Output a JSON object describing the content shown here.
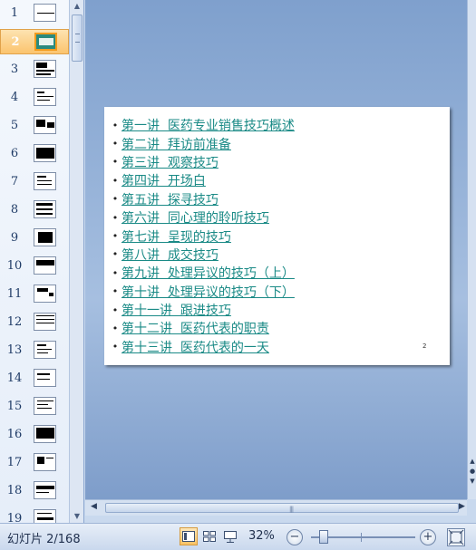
{
  "thumbnails": {
    "slides": [
      {
        "number": "1"
      },
      {
        "number": "2"
      },
      {
        "number": "3"
      },
      {
        "number": "4"
      },
      {
        "number": "5"
      },
      {
        "number": "6"
      },
      {
        "number": "7"
      },
      {
        "number": "8"
      },
      {
        "number": "9"
      },
      {
        "number": "10"
      },
      {
        "number": "11"
      },
      {
        "number": "12"
      },
      {
        "number": "13"
      },
      {
        "number": "14"
      },
      {
        "number": "15"
      },
      {
        "number": "16"
      },
      {
        "number": "17"
      },
      {
        "number": "18"
      },
      {
        "number": "19"
      }
    ],
    "selected": "2"
  },
  "slide": {
    "items": [
      "第一讲  医药专业销售技巧概述",
      "第二讲  拜访前准备",
      "第三讲  观察技巧",
      "第四讲  开场白",
      "第五讲  探寻技巧",
      "第六讲  同心理的聆听技巧",
      "第七讲  呈现的技巧",
      "第八讲  成交技巧",
      "第九讲  处理异议的技巧（上）",
      "第十讲  处理异议的技巧（下）",
      "第十一讲  跟进技巧",
      "第十二讲  医药代表的职责",
      "第十三讲  医药代表的一天"
    ],
    "bullet": "•",
    "page_number": "2",
    "link_color": "#1a8a86"
  },
  "status_bar": {
    "slide_counter": "幻灯片 2/168",
    "zoom": "32%",
    "zoom_percent": 32,
    "zoom_out_symbol": "−",
    "zoom_in_symbol": "+"
  }
}
